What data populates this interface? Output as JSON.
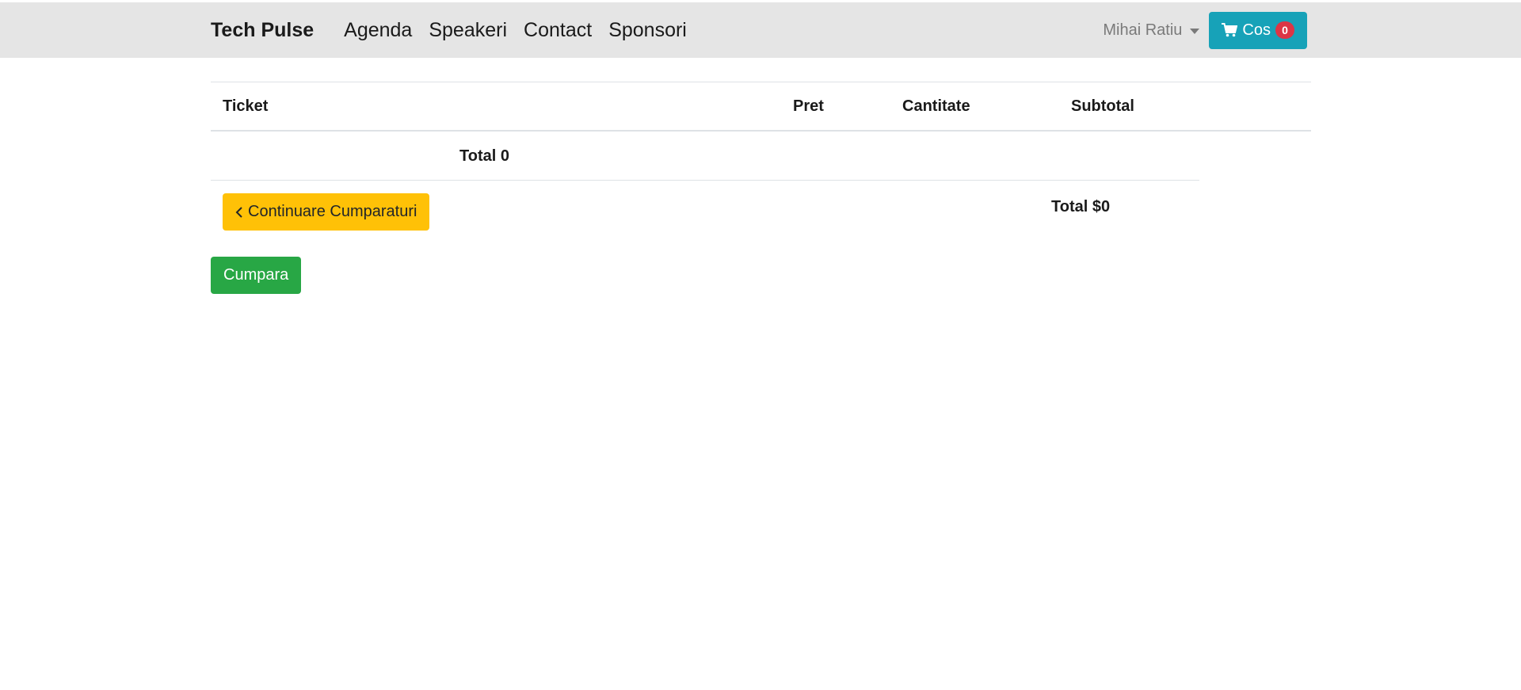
{
  "navbar": {
    "brand": "Tech Pulse",
    "links": [
      "Agenda",
      "Speakeri",
      "Contact",
      "Sponsori"
    ],
    "user_name": "Mihai Ratiu",
    "cart_label": "Cos",
    "cart_count": "0"
  },
  "cart_table": {
    "headers": [
      "Ticket",
      "Pret",
      "Cantitate",
      "Subtotal"
    ],
    "total_count_text": "Total 0",
    "continue_label": "Continuare Cumparaturi",
    "grand_total_text": "Total $0"
  },
  "buy_label": "Cumpara",
  "colors": {
    "navbar_bg": "#e5e5e5",
    "cart_button": "#17a2b8",
    "badge": "#dc3545",
    "continue_button": "#ffc107",
    "buy_button": "#28a745"
  },
  "icons": {
    "cart": "shopping-cart-icon",
    "continue": "chevron-left-icon",
    "user_menu": "caret-down-icon"
  }
}
